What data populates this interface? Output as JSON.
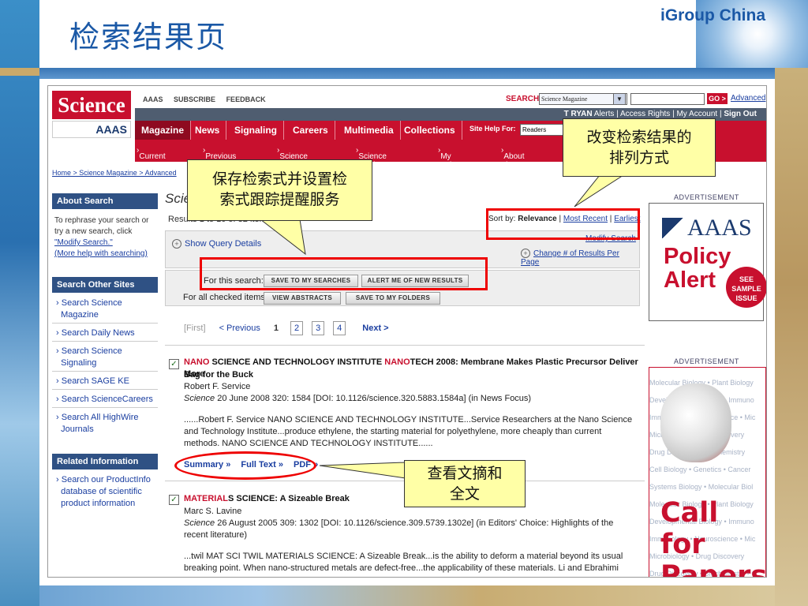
{
  "slide": {
    "title": "检索结果页",
    "brand": "iGroup China"
  },
  "site": {
    "logo": "Science",
    "aaas_small": "AAAS",
    "top_links": [
      "AAAS",
      "SUBSCRIBE",
      "FEEDBACK"
    ],
    "search_label": "SEARCH:",
    "search_scope": "Science Magazine",
    "go_label": "GO >",
    "advanced_link": "Advanced",
    "account_bar": {
      "user": "T RYAN",
      "links": [
        "Alerts",
        "Access Rights",
        "My Account"
      ],
      "sign_out": "Sign Out"
    },
    "nav": [
      "Magazine",
      "News",
      "Signaling",
      "Careers",
      "Multimedia",
      "Collections"
    ],
    "site_help_label": "Site Help For:",
    "site_help_value": "Readers",
    "subnav": [
      "Current Issue",
      "Previous Issues",
      "Science Express",
      "Science Products",
      "My Science",
      "About the Journal"
    ],
    "breadcrumb": "Home > Science Magazine > Advanced"
  },
  "sidebar": {
    "about_title": "About Search",
    "about_text_1": "To rephrase your search or",
    "about_text_2": "try a new search, click",
    "about_link_1": "\"Modify Search.\"",
    "about_link_2": "(More help with searching)",
    "other_title": "Search Other Sites",
    "other_links": [
      [
        "Search Science",
        "Magazine"
      ],
      [
        "Search Daily News"
      ],
      [
        "Search Science",
        "Signaling"
      ],
      [
        "Search SAGE KE"
      ],
      [
        "Search ScienceCareers"
      ],
      [
        "Search All HighWire",
        "Journals"
      ]
    ],
    "related_title": "Related Information",
    "related_links": [
      "Search our ProductInfo",
      "database of scientific",
      "product information"
    ]
  },
  "main": {
    "title": "Scie",
    "results_count": "Results 1 to 10 of 32 items",
    "sort_label": "Sort by:",
    "sort_active": "Relevance",
    "sort_options": [
      "Most Recent",
      "Earliest"
    ],
    "show_query": "Show Query Details",
    "modify_search": "Modify Search",
    "change_results": "Change # of Results Per Page",
    "for_search_label": "For this search:",
    "save_search_btn": "SAVE TO MY SEARCHES",
    "alert_btn": "ALERT ME OF NEW RESULTS",
    "for_checked_label": "For all checked items:",
    "view_abstracts_btn": "VIEW ABSTRACTS",
    "save_folders_btn": "SAVE TO MY FOLDERS",
    "pager": {
      "first": "[First]",
      "prev": "< Previous",
      "current": "1",
      "pages": [
        "2",
        "3",
        "4"
      ],
      "next": "Next >"
    },
    "results": [
      {
        "title_parts": [
          "NANO",
          " SCIENCE AND TECHNOLOGY INSTITUTE ",
          "NANO",
          "TECH 2008: Membrane Makes Plastic Precursor Deliver More"
        ],
        "title_line2": "Bag for the Buck",
        "author": "Robert F. Service",
        "journal": "Science",
        "citation": " 20 June 2008 320: 1584 [DOI: 10.1126/science.320.5883.1584a] (in News Focus)",
        "snippet_1": "......Robert F. Service NANO SCIENCE AND TECHNOLOGY INSTITUTE...Service Researchers at the Nano Science",
        "snippet_2": "and Technology Institute...produce ethylene, the starting material for polyethylene, more cheaply than current",
        "snippet_3": "methods. NANO SCIENCE AND TECHNOLOGY INSTITUTE......",
        "links": [
          "Summary »",
          "Full Text »",
          "PDF »"
        ]
      },
      {
        "title_parts": [
          "MATERIAL",
          "S SCIENCE: A Sizeable Break"
        ],
        "author": "Marc S. Lavine",
        "journal": "Science",
        "citation": " 26 August 2005 309: 1302 [DOI: 10.1126/science.309.5739.1302e] (in Editors' Choice: Highlights of the",
        "citation_2": "recent literature)",
        "snippet_1": "...twil MAT SCI TWIL MATERIALS SCIENCE: A Sizeable Break...is the ability to deform a material beyond its usual",
        "snippet_2": "breaking point. When nano-structured metals are defect-free...the applicability of these materials. Li and Ebrahimi"
      }
    ]
  },
  "ads": {
    "label": "ADVERTISEMENT",
    "ad1_brand": "AAAS",
    "ad1_policy": "Policy",
    "ad1_alert": "Alert",
    "ad1_badge": [
      "SEE",
      "SAMPLE",
      "ISSUE"
    ],
    "ad2_bg_lines": [
      "Molecular Biology • Plant Biology",
      "Developmental Biology • Immuno",
      "Immunology • Neuroscience • Mic",
      "Microbiology • Drug Discovery",
      "Drug Discovery • Biochemistry",
      "Cell Biology • Genetics • Cancer",
      "Systems Biology • Molecular Biol",
      "Molecular Biology • Plant Biology",
      "Developmental Biology • Immuno",
      "Immunology • Neuroscience • Mic",
      "Microbiology • Drug Discovery",
      "Drug Discovery • Biochemistry • C"
    ],
    "ad2_call": "Call for",
    "ad2_papers": "Papers"
  },
  "annotations": {
    "save_callout": [
      "保存检索式并设置检",
      "索式跟踪提醒服务"
    ],
    "sort_callout": [
      "改变检索结果的",
      "排列方式"
    ],
    "abstract_callout": [
      "查看文摘和",
      "全文"
    ]
  }
}
